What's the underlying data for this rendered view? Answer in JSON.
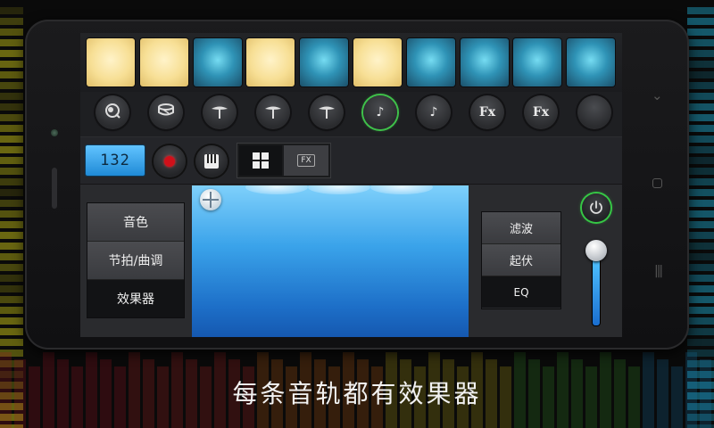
{
  "caption": "每条音轨都有效果器",
  "colors": {
    "accent": "#3fc04a",
    "pad_on": "#f7df95",
    "pad_off": "#2f93b6",
    "bpm_display": "#62c4ff",
    "record": "#d0101a"
  },
  "pads": [
    {
      "state": "on"
    },
    {
      "state": "on"
    },
    {
      "state": "off"
    },
    {
      "state": "on"
    },
    {
      "state": "off"
    },
    {
      "state": "on"
    },
    {
      "state": "off"
    },
    {
      "state": "off"
    },
    {
      "state": "off"
    },
    {
      "state": "off"
    }
  ],
  "instruments": [
    {
      "icon": "drum-icon",
      "label": ""
    },
    {
      "icon": "snare-icon",
      "label": ""
    },
    {
      "icon": "cymbal-icon",
      "label": ""
    },
    {
      "icon": "cymbal-icon",
      "label": ""
    },
    {
      "icon": "cymbal-icon",
      "label": ""
    },
    {
      "icon": "music-note-icon",
      "label": "♪",
      "selected": true
    },
    {
      "icon": "music-note-icon",
      "label": "♪"
    },
    {
      "icon": "fx-icon",
      "label": "Fx"
    },
    {
      "icon": "fx-icon",
      "label": "Fx"
    },
    {
      "icon": "empty-slot-icon",
      "label": ""
    }
  ],
  "controls": {
    "bpm": "132",
    "record_icon": "record-icon",
    "piano_icon": "piano-icon",
    "view_grid_icon": "grid-icon",
    "view_fx_label": "FX"
  },
  "left_menu": [
    "音色",
    "节拍/曲调",
    "效果器"
  ],
  "right_menu": [
    "滤波",
    "起伏",
    "EQ"
  ],
  "power_icon": "power-icon",
  "volume": {
    "level": 0.85
  }
}
